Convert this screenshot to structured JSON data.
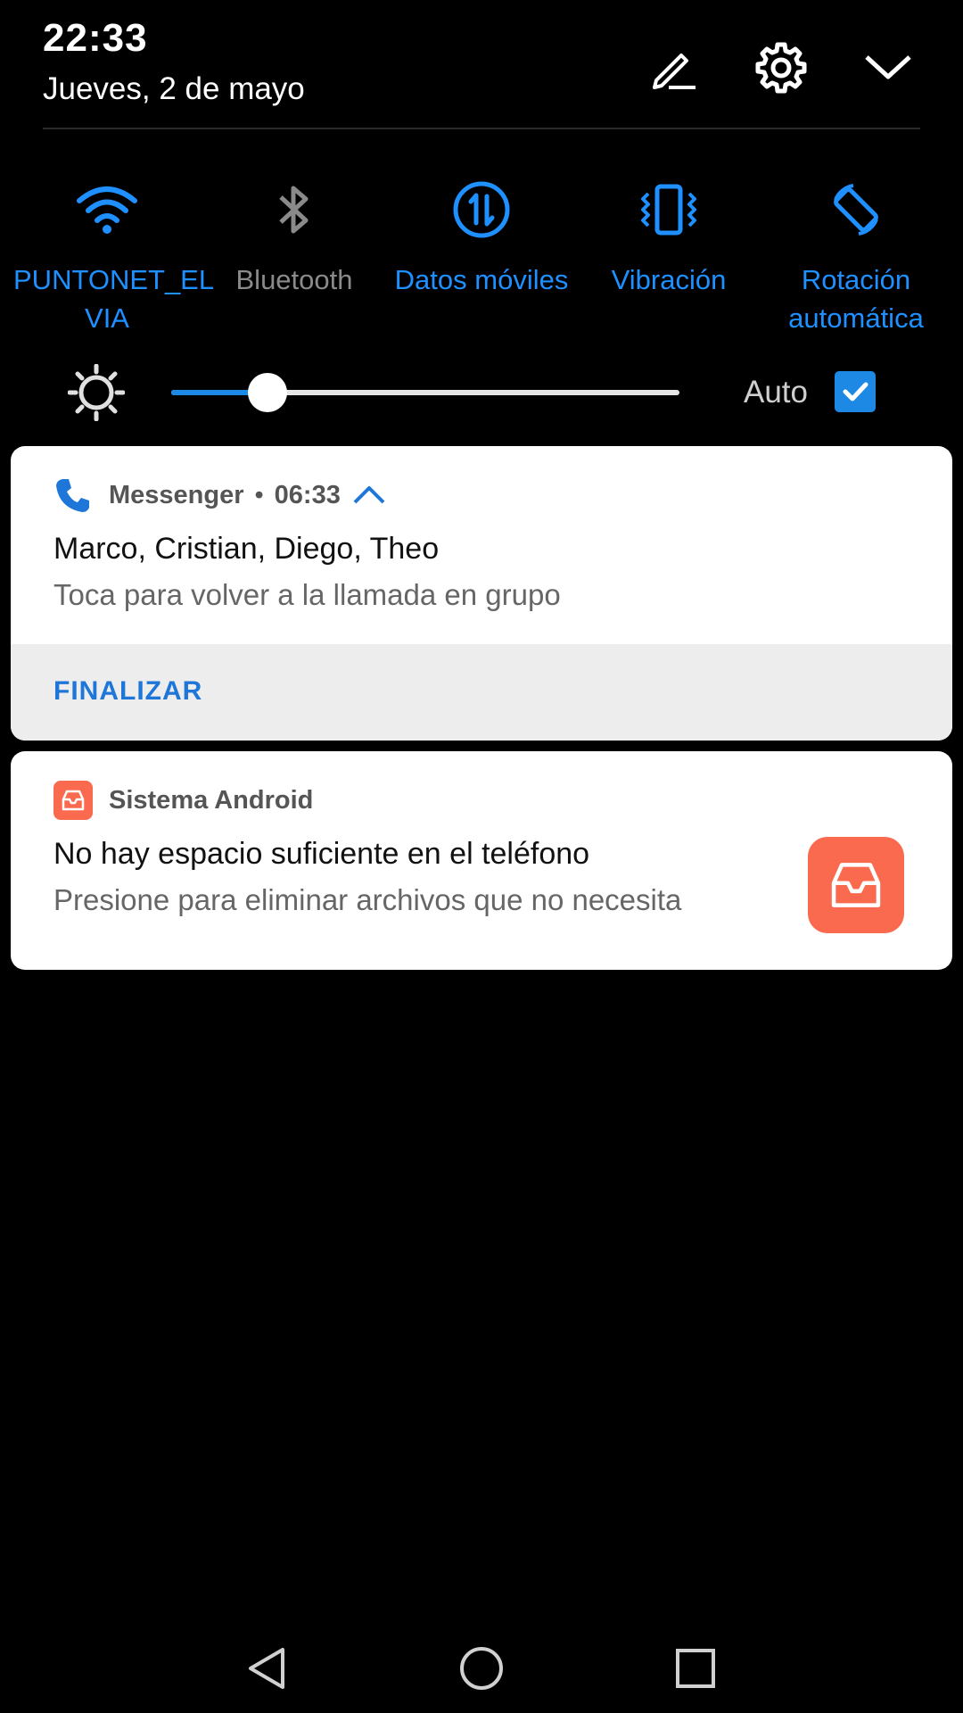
{
  "status": {
    "time": "22:33",
    "date": "Jueves, 2 de mayo"
  },
  "header_icons": [
    "edit-icon",
    "gear-icon",
    "chevron-down-icon"
  ],
  "quick_settings": [
    {
      "label": "PUNTONET_EL\nVIA",
      "icon": "wifi-icon",
      "active": true
    },
    {
      "label": "Bluetooth",
      "icon": "bluetooth-icon",
      "active": false
    },
    {
      "label": "Datos móviles",
      "icon": "mobile-data-icon",
      "active": true
    },
    {
      "label": "Vibración",
      "icon": "vibration-icon",
      "active": true
    },
    {
      "label": "Rotación\nautomática",
      "icon": "auto-rotate-icon",
      "active": true
    }
  ],
  "brightness": {
    "level": 0.19,
    "auto_label": "Auto",
    "auto_checked": true
  },
  "notifications": [
    {
      "app": "Messenger",
      "separator": "•",
      "time": "06:33",
      "title": "Marco, Cristian, Diego, Theo",
      "text": "Toca para volver a la llamada en grupo",
      "action": "FINALIZAR",
      "icon": "phone-icon"
    },
    {
      "app": "Sistema Android",
      "title": "No hay espacio suficiente en el teléfono",
      "text": "Presione para eliminar archivos que no necesita",
      "icon": "storage-icon"
    }
  ],
  "colors": {
    "accent": "#1e88e5",
    "inactive": "#8a8a8a",
    "android_orange": "#fa6a4f"
  },
  "nav": [
    "back-icon",
    "home-icon",
    "recents-icon"
  ]
}
